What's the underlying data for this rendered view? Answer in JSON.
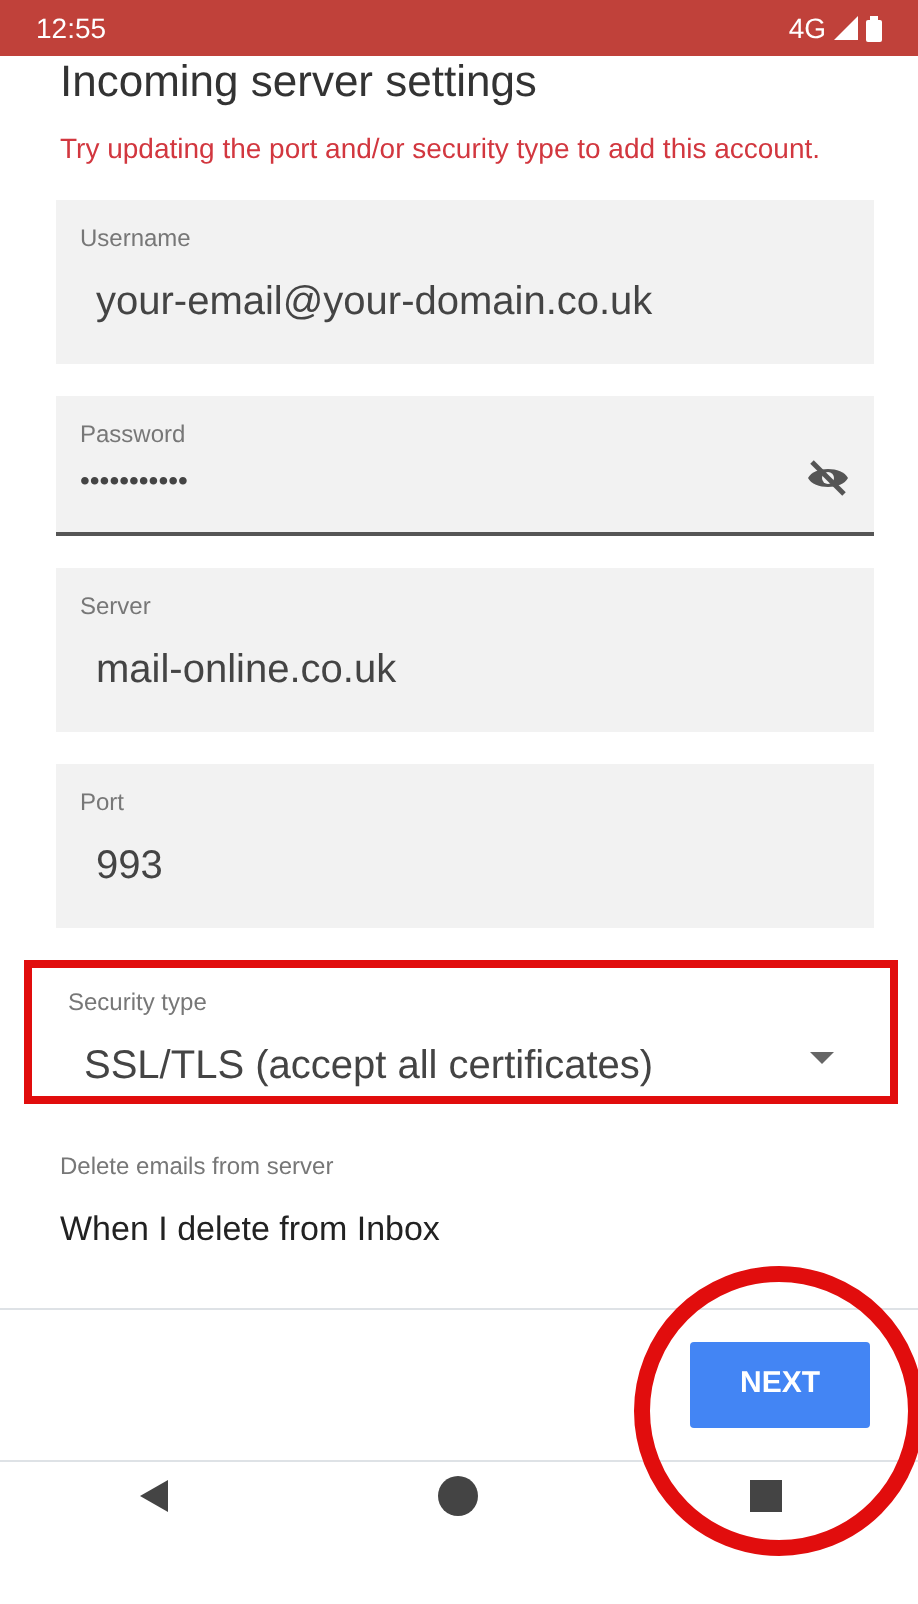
{
  "status_bar": {
    "time": "12:55",
    "network": "4G"
  },
  "title": "Incoming server settings",
  "error_message": "Try updating the port and/or security type to add this account.",
  "fields": [
    {
      "kind": "text",
      "label": "Username",
      "value": "your-email@your-domain.co.uk",
      "highlighted": false
    },
    {
      "kind": "password",
      "label": "Password",
      "value": "•••••••••••",
      "highlighted": false
    },
    {
      "kind": "text",
      "label": "Server",
      "value": "mail-online.co.uk",
      "highlighted": false
    },
    {
      "kind": "text",
      "label": "Port",
      "value": "993",
      "highlighted": false
    },
    {
      "kind": "dropdown",
      "label": "Security type",
      "value": "SSL/TLS (accept all certificates)",
      "highlighted": true
    },
    {
      "kind": "dropdown-small",
      "label": "Delete emails from server",
      "value": "When I delete from Inbox",
      "highlighted": false
    }
  ],
  "next_button": {
    "label": "NEXT",
    "circled": true
  }
}
